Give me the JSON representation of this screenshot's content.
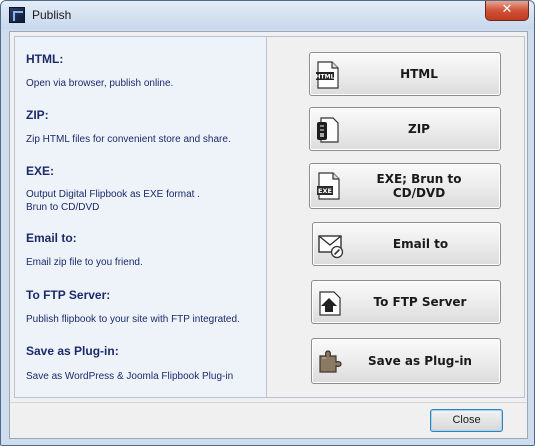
{
  "window": {
    "title": "Publish",
    "close_glyph": "✕"
  },
  "sections": [
    {
      "title": "HTML:",
      "desc": "Open via browser, publish online."
    },
    {
      "title": "ZIP:",
      "desc": "Zip HTML files for convenient store and share."
    },
    {
      "title": "EXE:",
      "desc_line1": "Output Digital Flipbook as EXE format .",
      "desc_line2": "Brun to CD/DVD"
    },
    {
      "title": "Email to:",
      "desc": "Email zip file to you friend."
    },
    {
      "title": "To FTP Server:",
      "desc": "Publish flipbook to your site with FTP integrated."
    },
    {
      "title": "Save as Plug-in:",
      "desc": "Save as WordPress & Joomla Flipbook Plug-in"
    }
  ],
  "buttons": [
    {
      "label": "HTML",
      "icon": "html-file-icon",
      "icon_text": "HTML"
    },
    {
      "label": "ZIP",
      "icon": "zip-file-icon"
    },
    {
      "label_line1": "EXE; Brun to",
      "label_line2": "CD/DVD",
      "icon": "exe-file-icon",
      "icon_text": "EXE"
    },
    {
      "label": "Email to",
      "icon": "email-icon"
    },
    {
      "label": "To FTP Server",
      "icon": "ftp-upload-icon"
    },
    {
      "label": "Save as Plug-in",
      "icon": "puzzle-plugin-icon"
    }
  ],
  "footer": {
    "close_label": "Close"
  }
}
